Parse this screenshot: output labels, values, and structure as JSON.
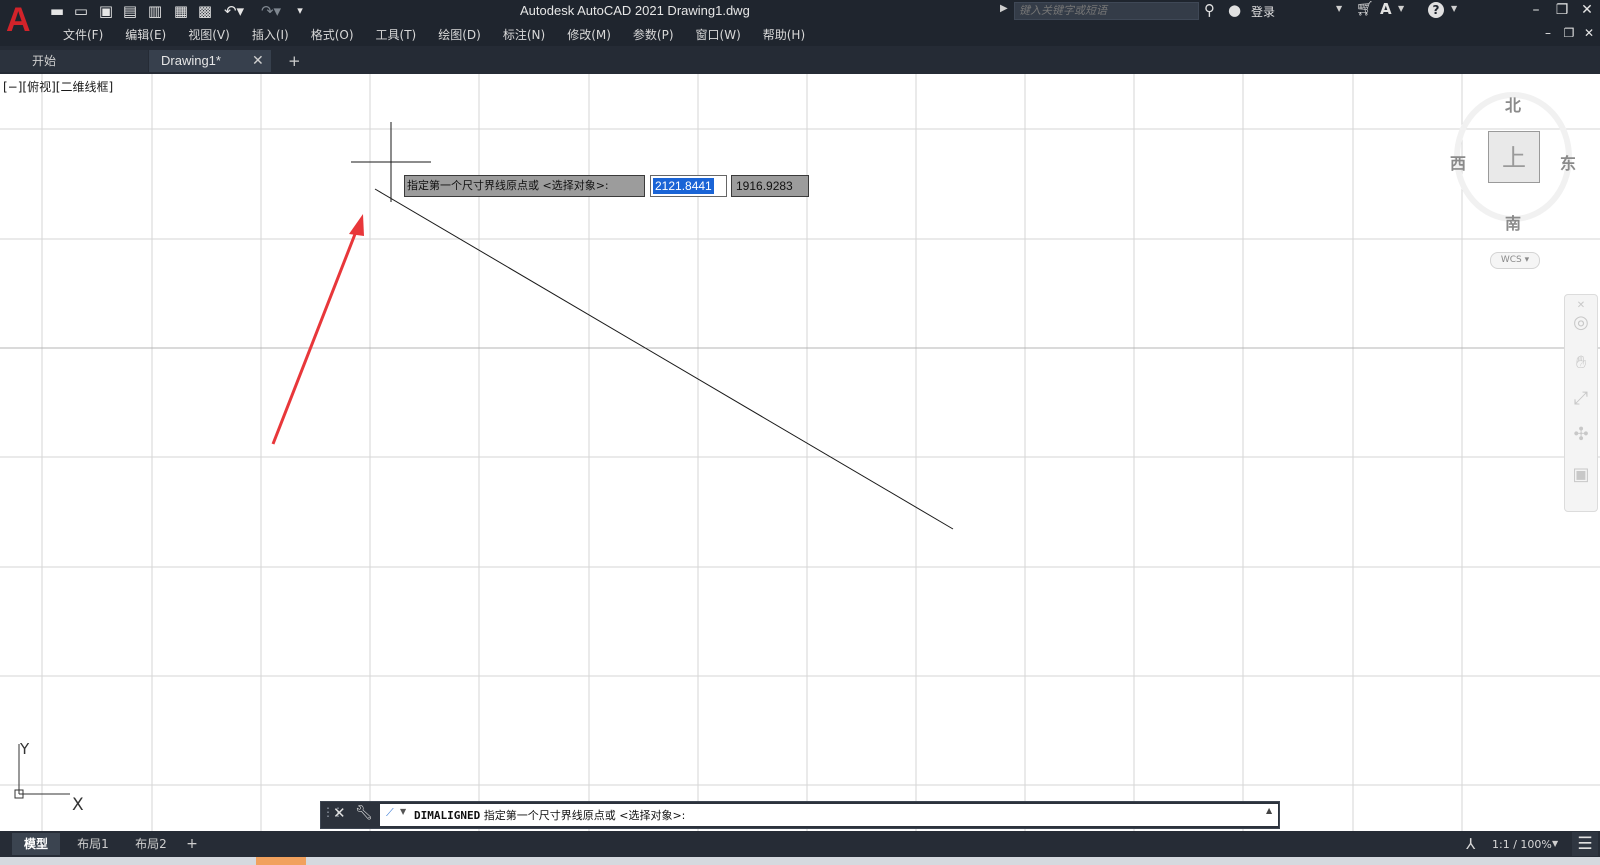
{
  "title_bar": {
    "title": "Autodesk AutoCAD 2021    Drawing1.dwg",
    "quick_access": [
      "new-icon",
      "open-icon",
      "save-icon",
      "save-as-icon",
      "publish-icon",
      "plot-icon",
      "print-icon",
      "undo-icon",
      "redo-icon",
      "customize-icon"
    ],
    "search_placeholder": "键入关键字或短语",
    "login_label": "登录"
  },
  "menu": {
    "items": [
      "文件(F)",
      "编辑(E)",
      "视图(V)",
      "插入(I)",
      "格式(O)",
      "工具(T)",
      "绘图(D)",
      "标注(N)",
      "修改(M)",
      "参数(P)",
      "窗口(W)",
      "帮助(H)"
    ]
  },
  "tabs": {
    "start": "开始",
    "drawing": "Drawing1*"
  },
  "viewport": {
    "label": "[−][俯视][二维线框]"
  },
  "dynamic_input": {
    "prompt": "指定第一个尺寸界线原点或 <选择对象>:",
    "x_value": "2121.8441",
    "y_value": "1916.9283"
  },
  "viewcube": {
    "north": "北",
    "south": "南",
    "east": "东",
    "west": "西",
    "top": "上",
    "wcs_label": "WCS"
  },
  "ucs": {
    "x_label": "X",
    "y_label": "Y"
  },
  "command_line": {
    "keyword": "DIMALIGNED",
    "prompt": " 指定第一个尺寸界线原点或 <选择对象>:"
  },
  "status_bar": {
    "layouts": [
      "模型",
      "布局1",
      "布局2"
    ],
    "scale": "1:1 / 100%"
  },
  "colors": {
    "dark_chrome": "#1f252e",
    "grid_line": "#d6d6d6",
    "arrow_red": "#e8373a",
    "selection_blue": "#1a64d6"
  }
}
